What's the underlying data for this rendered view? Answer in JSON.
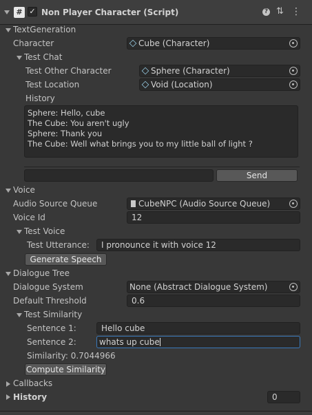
{
  "component": {
    "title": "Non Player Character (Script)"
  },
  "text_generation": {
    "section_label": "TextGeneration",
    "character_label": "Character",
    "character_value": "Cube (Character)",
    "test_chat_label": "Test Chat",
    "other_character_label": "Test Other Character",
    "other_character_value": "Sphere (Character)",
    "location_label": "Test Location",
    "location_value": "Void (Location)",
    "history_label": "History",
    "history_lines": [
      "Sphere: Hello, cube",
      "The Cube: You aren't ugly",
      "Sphere: Thank you",
      "The Cube: Well what brings you to my little ball of light ?"
    ],
    "chat_input_value": "",
    "send_label": "Send"
  },
  "voice": {
    "section_label": "Voice",
    "queue_label": "Audio Source Queue",
    "queue_value": "CubeNPC (Audio Source Queue)",
    "voice_id_label": "Voice Id",
    "voice_id_value": "12",
    "test_voice_label": "Test Voice",
    "utterance_label": "Test Utterance:",
    "utterance_value": "I pronounce it with voice 12",
    "generate_label": "Generate Speech"
  },
  "dialogue_tree": {
    "section_label": "Dialogue Tree",
    "system_label": "Dialogue System",
    "system_value": "None (Abstract Dialogue System)",
    "threshold_label": "Default Threshold",
    "threshold_value": "0.6",
    "test_similarity_label": "Test Similarity",
    "sentence1_label": "Sentence 1:",
    "sentence1_value": "Hello cube",
    "sentence2_label": "Sentence 2:",
    "sentence2_value": "whats up cube",
    "similarity_text": "Similarity: 0.7044966",
    "compute_label": "Compute Similarity"
  },
  "callbacks": {
    "section_label": "Callbacks"
  },
  "history_section": {
    "section_label": "History",
    "count_value": "0"
  }
}
